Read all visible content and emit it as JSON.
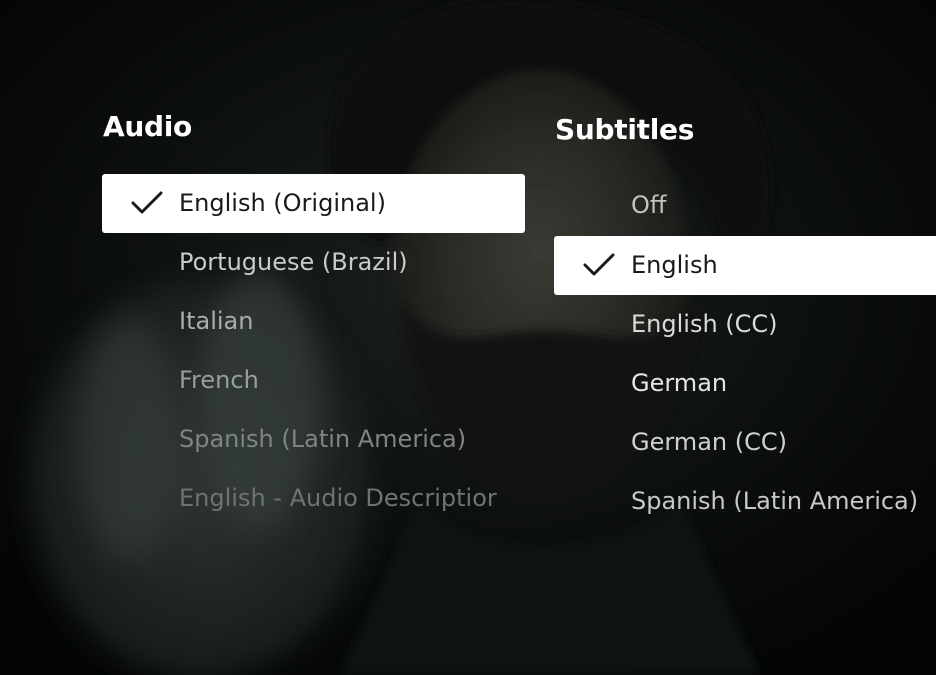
{
  "audio": {
    "title": "Audio",
    "options": [
      {
        "label": "English (Original)",
        "selected": true
      },
      {
        "label": "Portuguese (Brazil)",
        "selected": false
      },
      {
        "label": "Italian",
        "selected": false
      },
      {
        "label": "French",
        "selected": false
      },
      {
        "label": "Spanish (Latin America)",
        "selected": false
      },
      {
        "label": "English - Audio Descriptior",
        "selected": false
      }
    ]
  },
  "subtitles": {
    "title": "Subtitles",
    "options": [
      {
        "label": "Off",
        "selected": false
      },
      {
        "label": "English",
        "selected": true
      },
      {
        "label": "English (CC)",
        "selected": false
      },
      {
        "label": "German",
        "selected": false
      },
      {
        "label": "German (CC)",
        "selected": false
      },
      {
        "label": "Spanish (Latin America)",
        "selected": false
      }
    ]
  },
  "colors": {
    "selected_bg": "#ffffff",
    "selected_text": "#1a1a1a",
    "title_text": "#ffffff"
  },
  "icons": {
    "selected_marker": "check-icon"
  }
}
